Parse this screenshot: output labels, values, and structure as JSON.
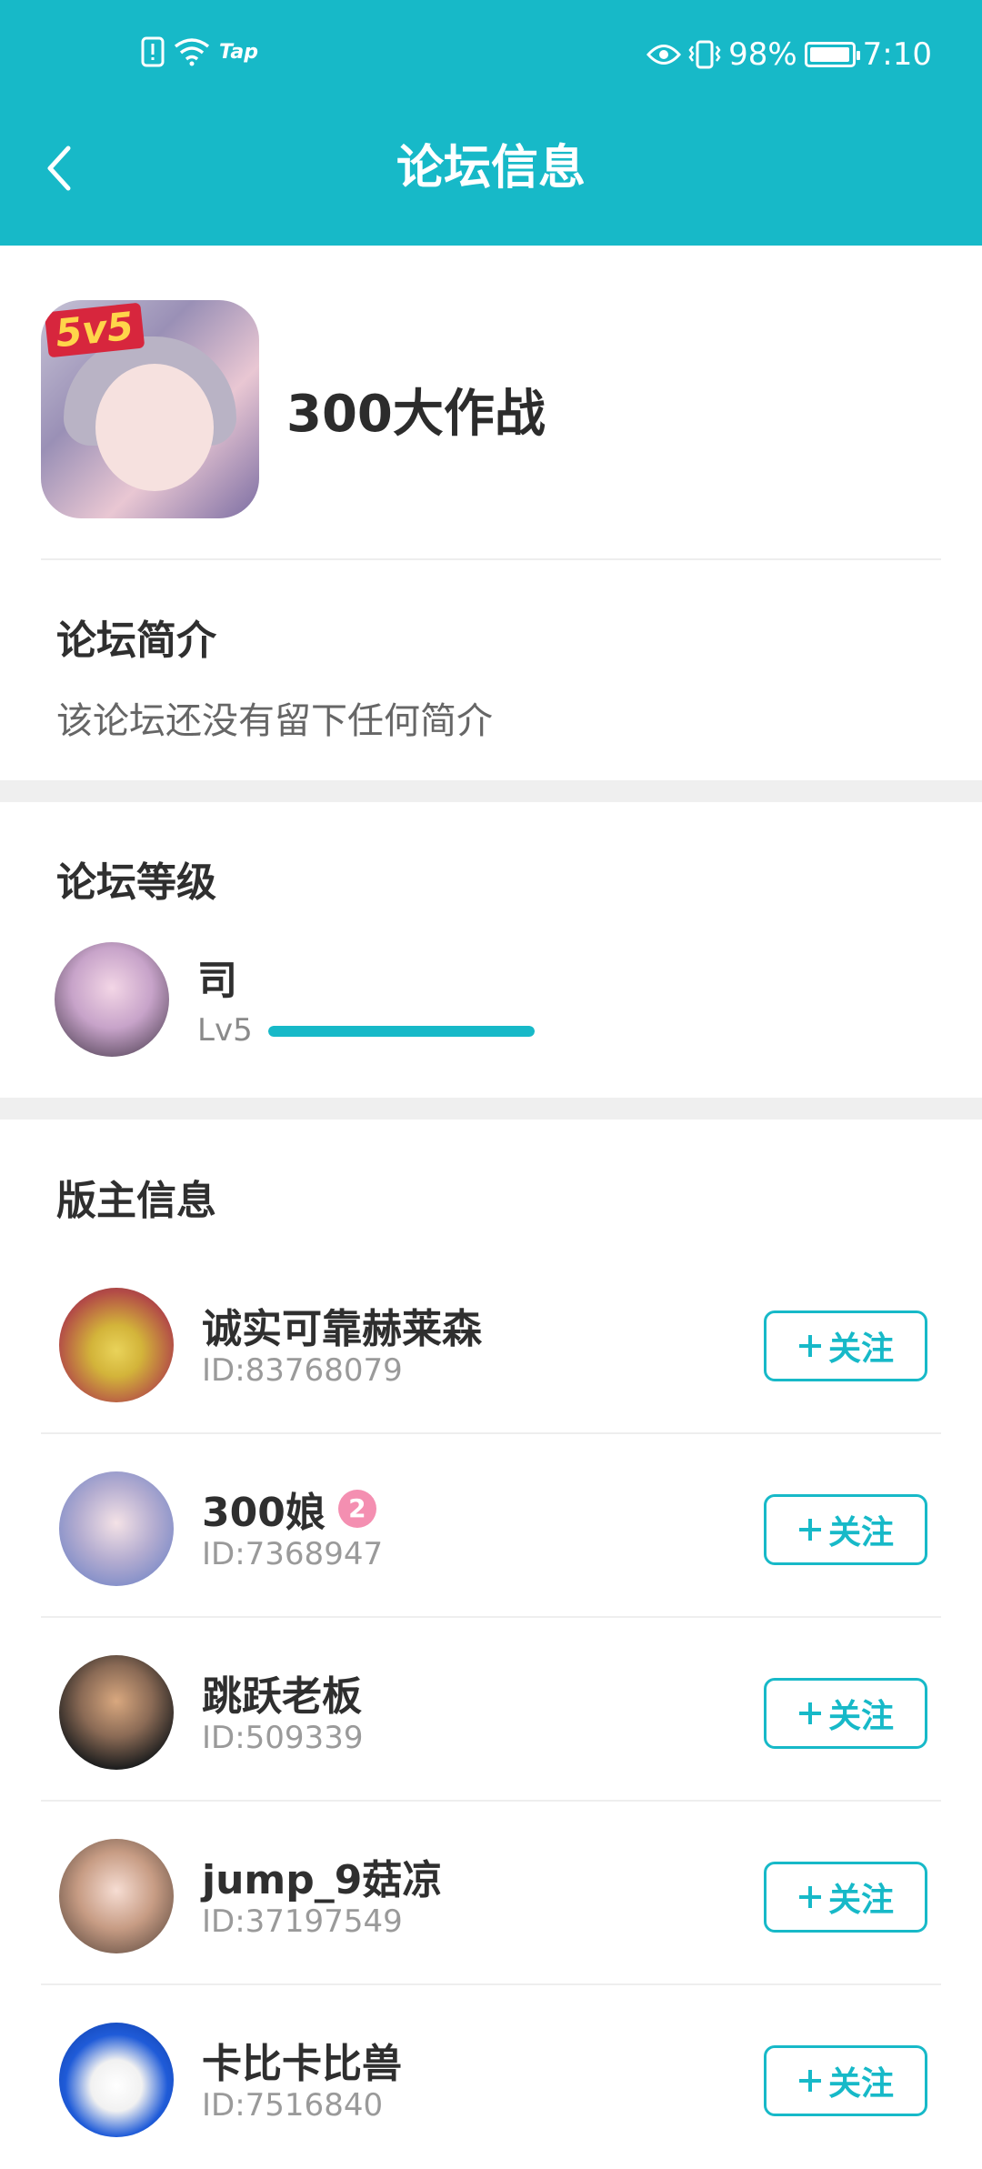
{
  "status_bar": {
    "left_label": "Tap",
    "battery_text": "98%",
    "battery_level": 0.98,
    "time": "7:10"
  },
  "header": {
    "title": "论坛信息"
  },
  "forum": {
    "icon_badge": "5v5",
    "name": "300大作战"
  },
  "intro": {
    "title": "论坛简介",
    "text": "该论坛还没有留下任何简介"
  },
  "level": {
    "title": "论坛等级",
    "name": "司",
    "label": "Lv5",
    "progress": 1.0
  },
  "moderators": {
    "title": "版主信息",
    "follow_label": "关注",
    "items": [
      {
        "name": "诚实可靠赫莱森",
        "id": "ID:83768079"
      },
      {
        "name": "300娘",
        "id": "ID:7368947",
        "badge": "2"
      },
      {
        "name": "跳跃老板",
        "id": "ID:509339"
      },
      {
        "name": "jump_9菇凉",
        "id": "ID:37197549"
      },
      {
        "name": "卡比卡比兽",
        "id": "ID:7516840"
      }
    ]
  },
  "colors": {
    "accent": "#17b9c8",
    "divider": "#efefef",
    "badge": "#f48fb1"
  }
}
